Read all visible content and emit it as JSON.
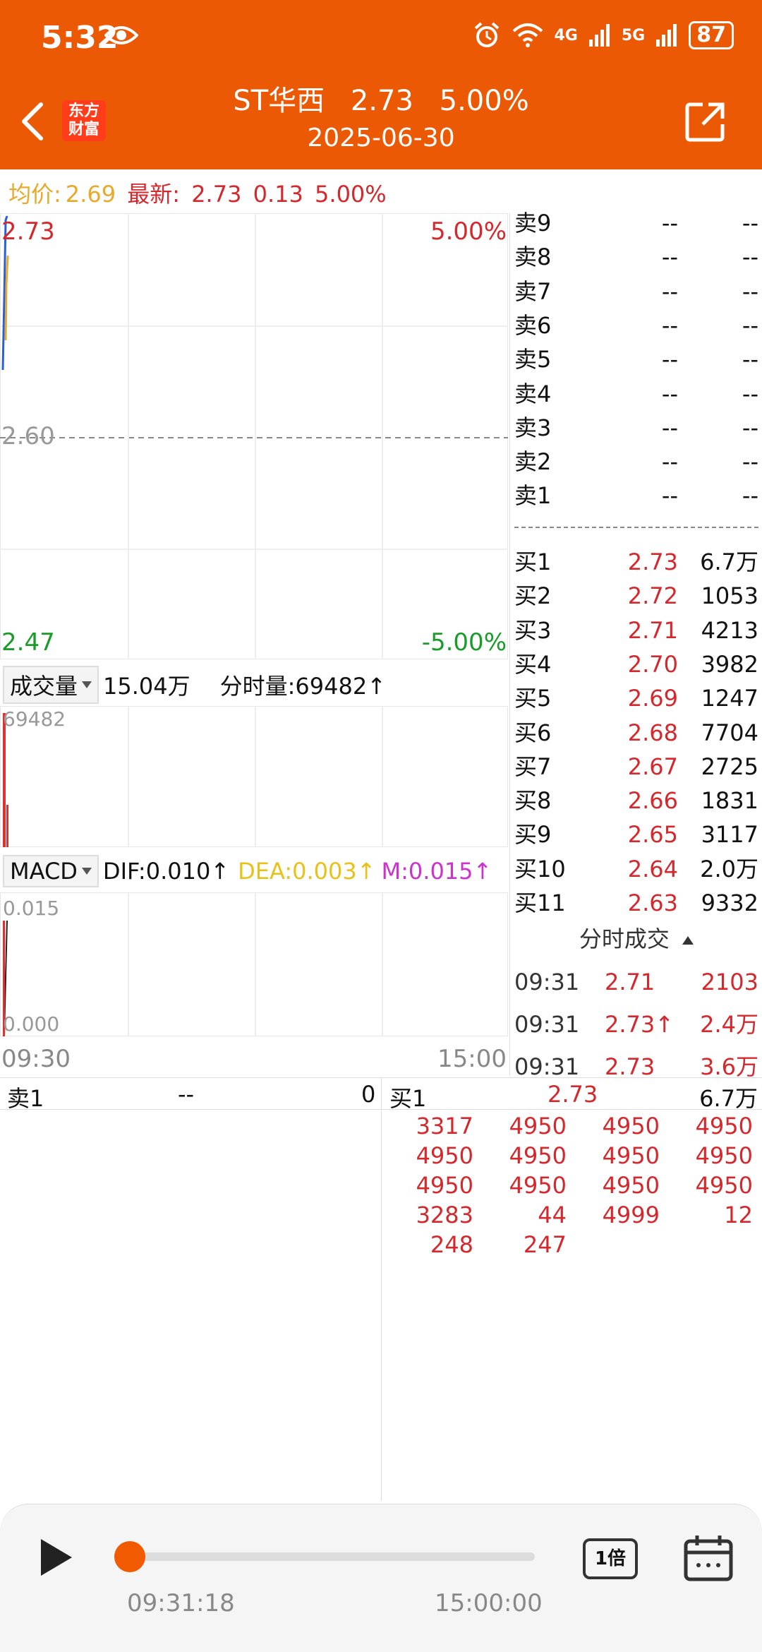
{
  "status": {
    "time": "5:32",
    "net1": "4G",
    "net2": "5G",
    "battery": "87"
  },
  "header": {
    "brand_line1": "东方",
    "brand_line2": "财富",
    "name": "ST华西",
    "price": "2.73",
    "pct": "5.00%",
    "date": "2025-06-30"
  },
  "info": {
    "avg_label": "均价:",
    "avg": "2.69",
    "latest_label": "最新:",
    "latest": "2.73",
    "change": "0.13",
    "pct": "5.00%"
  },
  "price_chart": {
    "top_price": "2.73",
    "top_pct": "5.00%",
    "mid_price": "2.60",
    "bottom_price": "2.47",
    "bottom_pct": "-5.00%"
  },
  "volume": {
    "label": "成交量",
    "total": "15.04万",
    "tick_label": "分时量:69482↑",
    "axis_max": "69482"
  },
  "macd": {
    "label": "MACD",
    "dif": "DIF:0.010↑",
    "dea": "DEA:0.003↑",
    "m": "M:0.015↑",
    "axis_max": "0.015",
    "axis_min": "0.000"
  },
  "time_axis": {
    "start": "09:30",
    "end": "15:00"
  },
  "sell_orders": [
    {
      "label": "卖9",
      "price": "--",
      "vol": "--"
    },
    {
      "label": "卖8",
      "price": "--",
      "vol": "--"
    },
    {
      "label": "卖7",
      "price": "--",
      "vol": "--"
    },
    {
      "label": "卖6",
      "price": "--",
      "vol": "--"
    },
    {
      "label": "卖5",
      "price": "--",
      "vol": "--"
    },
    {
      "label": "卖4",
      "price": "--",
      "vol": "--"
    },
    {
      "label": "卖3",
      "price": "--",
      "vol": "--"
    },
    {
      "label": "卖2",
      "price": "--",
      "vol": "--"
    },
    {
      "label": "卖1",
      "price": "--",
      "vol": "--"
    }
  ],
  "buy_orders": [
    {
      "label": "买1",
      "price": "2.73",
      "vol": "6.7万"
    },
    {
      "label": "买2",
      "price": "2.72",
      "vol": "1053"
    },
    {
      "label": "买3",
      "price": "2.71",
      "vol": "4213"
    },
    {
      "label": "买4",
      "price": "2.70",
      "vol": "3982"
    },
    {
      "label": "买5",
      "price": "2.69",
      "vol": "1247"
    },
    {
      "label": "买6",
      "price": "2.68",
      "vol": "7704"
    },
    {
      "label": "买7",
      "price": "2.67",
      "vol": "2725"
    },
    {
      "label": "买8",
      "price": "2.66",
      "vol": "1831"
    },
    {
      "label": "买9",
      "price": "2.65",
      "vol": "3117"
    },
    {
      "label": "买10",
      "price": "2.64",
      "vol": "2.0万"
    },
    {
      "label": "买11",
      "price": "2.63",
      "vol": "9332"
    }
  ],
  "ticks": {
    "title": "分时成交",
    "rows": [
      {
        "time": "09:31",
        "price": "2.71",
        "vol": "2103"
      },
      {
        "time": "09:31",
        "price": "2.73↑",
        "vol": "2.4万"
      },
      {
        "time": "09:31",
        "price": "2.73",
        "vol": "3.6万"
      }
    ]
  },
  "queue": {
    "sell_label": "卖1",
    "sell_price": "--",
    "sell_count": "0",
    "buy_label": "买1",
    "buy_price": "2.73",
    "buy_total": "6.7万",
    "rows": [
      [
        "3317",
        "4950",
        "4950",
        "4950"
      ],
      [
        "4950",
        "4950",
        "4950",
        "4950"
      ],
      [
        "4950",
        "4950",
        "4950",
        "4950"
      ],
      [
        "3283",
        "44",
        "4999",
        "12"
      ],
      [
        "248",
        "247",
        "",
        ""
      ]
    ]
  },
  "player": {
    "start": "09:31:18",
    "end": "15:00:00",
    "speed": "1倍",
    "progress": 0.0
  }
}
